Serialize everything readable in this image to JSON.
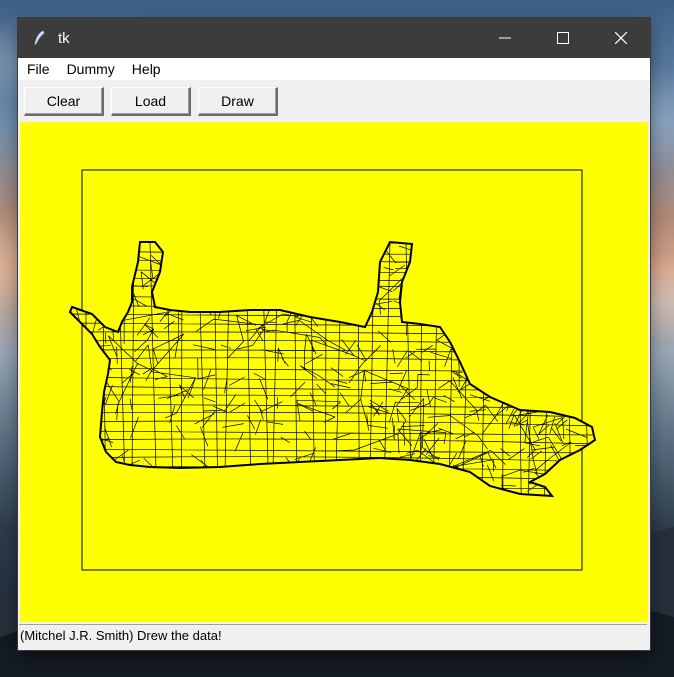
{
  "window": {
    "title": "tk"
  },
  "title_icon": "feather-icon",
  "window_controls": [
    "minimize-icon",
    "maximize-icon",
    "close-icon"
  ],
  "menubar": {
    "items": [
      "File",
      "Dummy",
      "Help"
    ]
  },
  "toolbar": {
    "buttons": [
      "Clear",
      "Load",
      "Draw"
    ]
  },
  "canvas": {
    "background": "#ffff00",
    "content": "wireframe-mesh-cow"
  },
  "status": {
    "text": "(Mitchel J.R. Smith) Drew the data!"
  }
}
